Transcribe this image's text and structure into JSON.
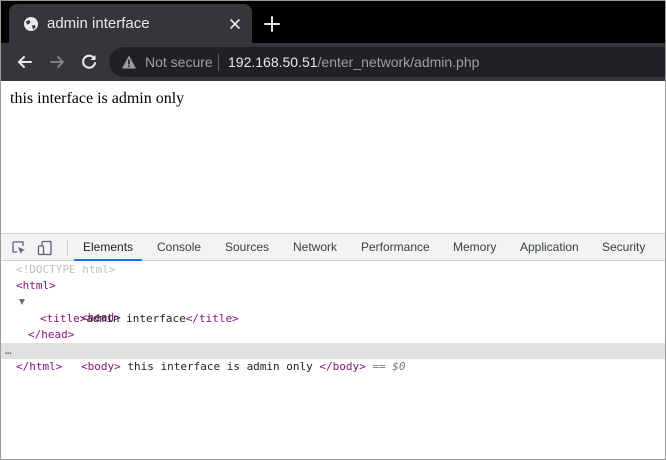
{
  "browser": {
    "tab_title": "admin interface",
    "security_label": "Not secure",
    "url_host": "192.168.50.51",
    "url_path": "/enter_network/admin.php"
  },
  "page": {
    "body_text": "this interface is admin only"
  },
  "devtools": {
    "tabs": [
      "Elements",
      "Console",
      "Sources",
      "Network",
      "Performance",
      "Memory",
      "Application",
      "Security"
    ],
    "active_tab": "Elements",
    "dom": {
      "doctype": "<!DOCTYPE html>",
      "html_open": "<html>",
      "head_open": "<head>",
      "title_open": "<title>",
      "title_text": "admin interface",
      "title_close": "</title>",
      "head_close": "</head>",
      "body_open": "<body>",
      "body_text": " this interface is admin only ",
      "body_close": "</body>",
      "selected_marker": "== $0",
      "html_close": "</html>",
      "ellipsis": "…"
    }
  },
  "colors": {
    "tab_strip": "#000000",
    "toolbar": "#35363a",
    "omnibox": "#202124",
    "tag": "#881280",
    "active_tab_underline": "#1a73e8"
  }
}
